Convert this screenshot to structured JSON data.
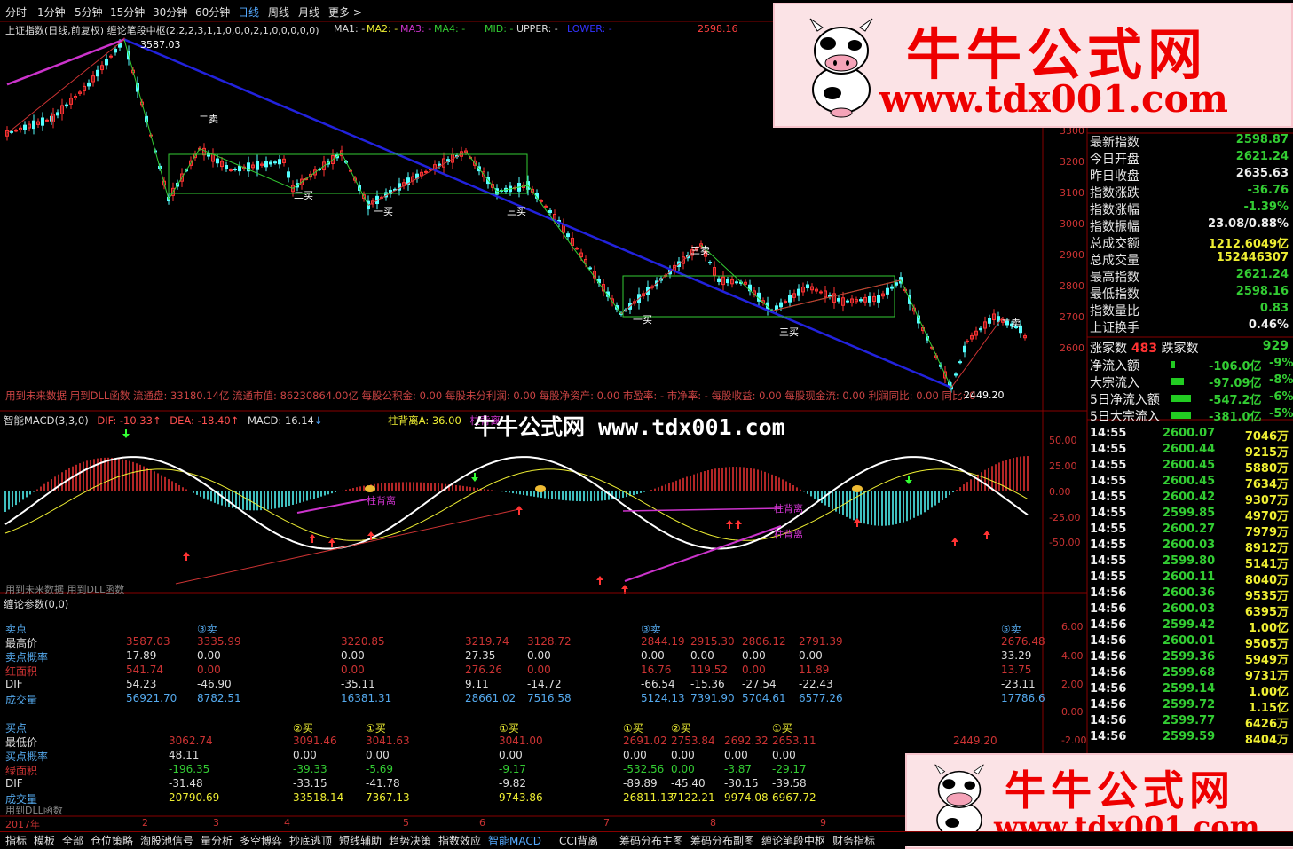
{
  "timeframes": [
    "分时",
    "1分钟",
    "5分钟",
    "15分钟",
    "30分钟",
    "60分钟",
    "日线",
    "周线",
    "月线",
    "更多 >"
  ],
  "selected_timeframe": "日线",
  "main_header": {
    "title": "上证指数(日线,前复权) 缠论笔段中枢(2,2,2,3,1,1,0,0,0,2,1,0,0,0,0,0)",
    "ma": [
      "MA1: -",
      "MA2: -",
      "MA3: -",
      "MA4: -",
      "MID: -",
      "UPPER: -",
      "LOWER: -"
    ],
    "right_val": "2598.16"
  },
  "main_labels": {
    "high_label": "3587.03",
    "low_label": "2449.20",
    "sell_2": "二卖",
    "buy_2": "二买",
    "buy_1": "一买",
    "buy_3": "三买",
    "sell_3": "三卖",
    "sell_2b": "二卖",
    "buy_3b": "三买"
  },
  "price_axis": [
    "3300",
    "3200",
    "3100",
    "3000",
    "2900",
    "2800",
    "2700",
    "2600"
  ],
  "info_line": "用到未来数据 用到DLL函数 流通盘: 33180.14亿  流通市值: 86230864.00亿  每股公积金: 0.00  每股未分利润: 0.00  每股净资产: 0.00  市盈率: -  市净率: -  每股收益: 0.00  每股现金流: 0.00  利润同比: 0.00  同比: 0",
  "macd_header": {
    "name": "智能MACD(3,3,0)",
    "dif": "DIF: -10.33",
    "dea": "DEA: -18.40",
    "macd": "MACD: 16.14",
    "zhu": "柱背离A: 36.00",
    "zhu2": "柱背离"
  },
  "macd_labels": {
    "div1": "柱背离",
    "div2": "柱背离",
    "div3": "柱背离",
    "footer": "用到未来数据 用到DLL函数"
  },
  "macd_axis": [
    "50.00",
    "25.00",
    "0.00",
    "-25.00",
    "-50.00"
  ],
  "chanlun_header": "缠论参数(0,0)",
  "chanlun_axis": [
    "6.00",
    "4.00",
    "2.00",
    "0.00",
    "-2.00"
  ],
  "sell_table": {
    "title": "卖点",
    "row_labels": [
      "最高价",
      "卖点概率",
      "红面积",
      "DIF",
      "成交量"
    ],
    "cols": [
      {
        "head": "",
        "v": [
          "3587.03",
          "17.89",
          "541.74",
          "54.23",
          "56921.70"
        ]
      },
      {
        "head": "③卖",
        "v": [
          "3335.99",
          "0.00",
          "0.00",
          "-46.90",
          "8782.51"
        ]
      },
      {
        "head": "",
        "v": [
          "3220.85",
          "0.00",
          "0.00",
          "-35.11",
          "16381.31"
        ]
      },
      {
        "head": "",
        "v": [
          "3219.74",
          "27.35",
          "276.26",
          "9.11",
          "28661.02"
        ]
      },
      {
        "head": "",
        "v": [
          "3128.72",
          "0.00",
          "0.00",
          "-14.72",
          "7516.58"
        ]
      },
      {
        "head": "③卖",
        "v": [
          "2844.19",
          "0.00",
          "16.76",
          "-66.54",
          "5124.13"
        ]
      },
      {
        "head": "",
        "v": [
          "2915.30",
          "0.00",
          "119.52",
          "-15.36",
          "7391.90"
        ]
      },
      {
        "head": "",
        "v": [
          "2806.12",
          "0.00",
          "0.00",
          "-27.54",
          "5704.61"
        ]
      },
      {
        "head": "",
        "v": [
          "2791.39",
          "0.00",
          "11.89",
          "-22.43",
          "6577.26"
        ]
      },
      {
        "head": "⑤卖",
        "v": [
          "2676.48",
          "33.29",
          "13.75",
          "-23.11",
          "17786.6"
        ]
      }
    ]
  },
  "buy_table": {
    "title": "买点",
    "row_labels": [
      "最低价",
      "买点概率",
      "绿面积",
      "DIF",
      "成交量"
    ],
    "cols": [
      {
        "head": "",
        "v": [
          "3062.74",
          "48.11",
          "-196.35",
          "-31.48",
          "20790.69"
        ]
      },
      {
        "head": "②买",
        "v": [
          "3091.46",
          "0.00",
          "-39.33",
          "-33.15",
          "33518.14"
        ]
      },
      {
        "head": "①买",
        "v": [
          "3041.63",
          "0.00",
          "-5.69",
          "-41.78",
          "7367.13"
        ]
      },
      {
        "head": "①买",
        "v": [
          "3041.00",
          "0.00",
          "-9.17",
          "-9.82",
          "9743.86"
        ]
      },
      {
        "head": "①买",
        "v": [
          "2691.02",
          "0.00",
          "-532.56",
          "-89.89",
          "26811.13"
        ]
      },
      {
        "head": "②买",
        "v": [
          "2753.84",
          "0.00",
          "0.00",
          "-45.40",
          "7122.21"
        ]
      },
      {
        "head": "",
        "v": [
          "2692.32",
          "0.00",
          "-3.87",
          "-30.15",
          "9974.08"
        ]
      },
      {
        "head": "①买",
        "v": [
          "2653.11",
          "0.00",
          "-29.17",
          "-39.58",
          "6967.72"
        ]
      },
      {
        "head": "",
        "v": [
          "2449.20",
          "",
          "",
          "",
          ""
        ]
      }
    ]
  },
  "year_axis": [
    "2017年",
    "2",
    "3",
    "4",
    "5",
    "6",
    "7",
    "8",
    "9"
  ],
  "right_stats": [
    {
      "label": "最新指数",
      "value": "2598.87",
      "color": "#3c3"
    },
    {
      "label": "今日开盘",
      "value": "2621.24",
      "color": "#3c3"
    },
    {
      "label": "昨日收盘",
      "value": "2635.63",
      "color": "#eee"
    },
    {
      "label": "指数涨跌",
      "value": "-36.76",
      "color": "#3c3"
    },
    {
      "label": "指数涨幅",
      "value": "-1.39%",
      "color": "#3c3"
    },
    {
      "label": "指数振幅",
      "value": "23.08/0.88%",
      "color": "#eee"
    },
    {
      "label": "总成交额",
      "value": "1212.6049亿",
      "color": "#ee3"
    },
    {
      "label": "总成交量",
      "value": "152446307",
      "color": "#ee3"
    },
    {
      "label": "最高指数",
      "value": "2621.24",
      "color": "#3c3"
    },
    {
      "label": "最低指数",
      "value": "2598.16",
      "color": "#3c3"
    },
    {
      "label": "指数量比",
      "value": "0.83",
      "color": "#3c3"
    },
    {
      "label": "上证换手",
      "value": "0.46%",
      "color": "#eee"
    }
  ],
  "updown": {
    "up_label": "涨家数",
    "up": "483",
    "down_label": "跌家数",
    "down": "929"
  },
  "flows": [
    {
      "label": "净流入额",
      "value": "-106.0亿",
      "pct": "-9%",
      "bar": 0.05
    },
    {
      "label": "大宗流入",
      "value": "-97.09亿",
      "pct": "-8%",
      "bar": 0.6
    },
    {
      "label": "5日净流入额",
      "value": "-547.2亿",
      "pct": "-6%",
      "bar": 0.9
    },
    {
      "label": "5日大宗流入",
      "value": "-381.0亿",
      "pct": "-5%",
      "bar": 0.9
    }
  ],
  "ticks": [
    {
      "t": "14:55",
      "p": "2600.07",
      "v": "7046万"
    },
    {
      "t": "14:55",
      "p": "2600.44",
      "v": "9215万"
    },
    {
      "t": "14:55",
      "p": "2600.45",
      "v": "5880万"
    },
    {
      "t": "14:55",
      "p": "2600.45",
      "v": "7634万"
    },
    {
      "t": "14:55",
      "p": "2600.42",
      "v": "9307万"
    },
    {
      "t": "14:55",
      "p": "2599.85",
      "v": "4970万"
    },
    {
      "t": "14:55",
      "p": "2600.27",
      "v": "7979万"
    },
    {
      "t": "14:55",
      "p": "2600.03",
      "v": "8912万"
    },
    {
      "t": "14:55",
      "p": "2599.80",
      "v": "5141万"
    },
    {
      "t": "14:55",
      "p": "2600.11",
      "v": "8040万"
    },
    {
      "t": "14:56",
      "p": "2600.36",
      "v": "9535万"
    },
    {
      "t": "14:56",
      "p": "2600.03",
      "v": "6395万"
    },
    {
      "t": "14:56",
      "p": "2599.42",
      "v": "1.00亿"
    },
    {
      "t": "14:56",
      "p": "2600.01",
      "v": "9505万"
    },
    {
      "t": "14:56",
      "p": "2599.36",
      "v": "5949万"
    },
    {
      "t": "14:56",
      "p": "2599.68",
      "v": "9731万"
    },
    {
      "t": "14:56",
      "p": "2599.14",
      "v": "1.00亿"
    },
    {
      "t": "14:56",
      "p": "2599.72",
      "v": "1.15亿"
    },
    {
      "t": "14:56",
      "p": "2599.77",
      "v": "6426万"
    },
    {
      "t": "14:56",
      "p": "2599.59",
      "v": "8404万"
    }
  ],
  "bottom_tabs": [
    "指标",
    "模板",
    "全部",
    "仓位策略",
    "淘股池信号",
    "量分析",
    "多空博弈",
    "抄底逃顶",
    "短线辅助",
    "趋势决策",
    "指数效应",
    "智能MACD",
    "CCI背离",
    "筹码分布主图",
    "筹码分布副图",
    "缠论笔段中枢",
    "财务指标"
  ],
  "selected_bottom_tab": "智能MACD",
  "watermark": {
    "cn": "牛牛公式网",
    "url": "www.tdx001.com",
    "mid": "牛牛公式网 www.tdx001.com"
  },
  "colors": {
    "bg": "#000000",
    "up": "#ff3232",
    "down": "#54ffff",
    "trend": "#2222dd",
    "magenta": "#cc33cc",
    "zs": "#33cc33"
  }
}
